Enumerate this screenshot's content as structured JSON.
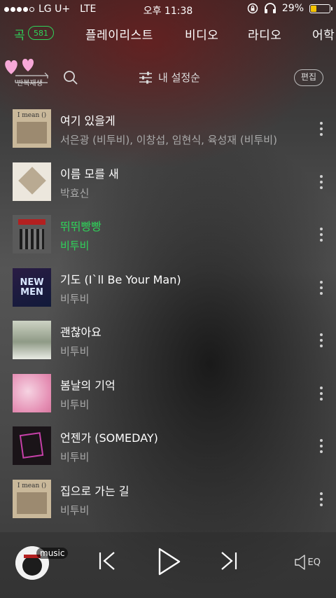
{
  "status_bar": {
    "carrier": "LG U+",
    "network": "LTE",
    "time": "오후 11:38",
    "battery": "29%"
  },
  "tabs": [
    {
      "label": "곡",
      "count": "581",
      "active": true
    },
    {
      "label": "플레이리스트"
    },
    {
      "label": "비디오"
    },
    {
      "label": "라디오"
    },
    {
      "label": "어학"
    }
  ],
  "toolbar": {
    "repeat_label": "반복재생",
    "sort_label": "내 설정순",
    "edit_label": "편집"
  },
  "songs": [
    {
      "title": "여기 있을게",
      "artist": "서은광 (비투비), 이창섭, 임현식, 육성재 (비투비)",
      "art": "sand"
    },
    {
      "title": "이름 모를 새",
      "artist": "박효신",
      "art": "cream"
    },
    {
      "title": "뛰뛰빵빵",
      "artist": "비투비",
      "art": "grey",
      "playing": true
    },
    {
      "title": "기도 (I`ll Be Your Man)",
      "artist": "비투비",
      "art": "purple"
    },
    {
      "title": "괜찮아요",
      "artist": "비투비",
      "art": "pale"
    },
    {
      "title": "봄날의 기억",
      "artist": "비투비",
      "art": "pink"
    },
    {
      "title": "언젠가 (SOMEDAY)",
      "artist": "비투비",
      "art": "dark"
    },
    {
      "title": "집으로 가는 길",
      "artist": "비투비",
      "art": "sand"
    }
  ],
  "player": {
    "tag": "music",
    "eq_label": "EQ"
  },
  "colors": {
    "accent": "#2fd35a",
    "battery": "#f5c400"
  }
}
